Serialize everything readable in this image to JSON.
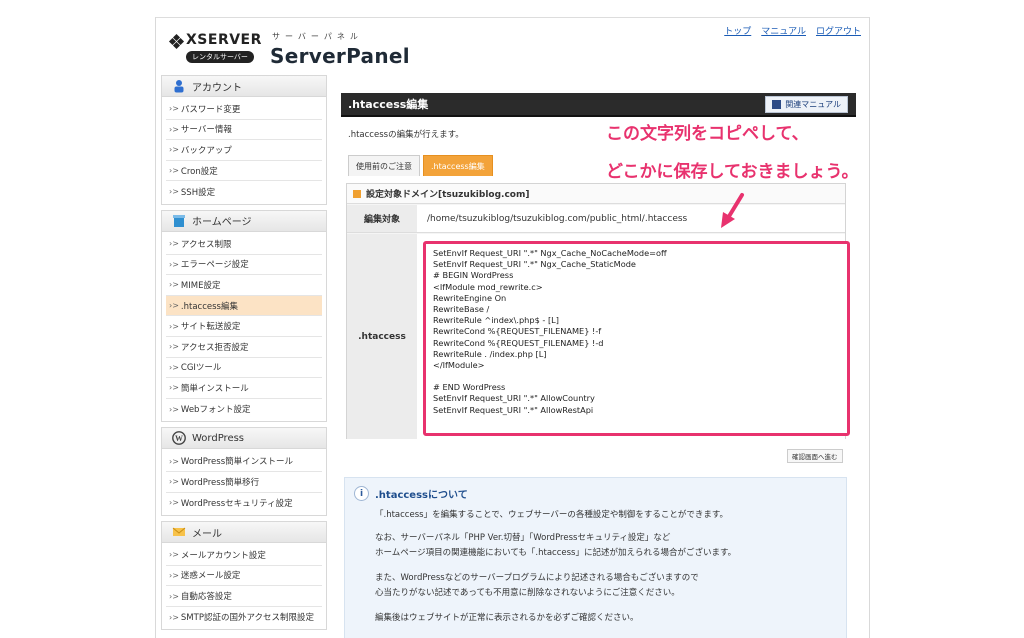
{
  "header": {
    "brand": "XSERVER",
    "badge": "レンタルサーバー",
    "kana": "サーバーパネル",
    "product": "ServerPanel",
    "links": [
      "トップ",
      "マニュアル",
      "ログアウト"
    ]
  },
  "sidebar": {
    "sections": [
      {
        "title": "アカウント",
        "icon": "person-icon",
        "items": [
          "パスワード変更",
          "サーバー情報",
          "バックアップ",
          "Cron設定",
          "SSH設定"
        ]
      },
      {
        "title": "ホームページ",
        "icon": "homepage-icon",
        "items": [
          "アクセス制限",
          "エラーページ設定",
          "MIME設定",
          ".htaccess編集",
          "サイト転送設定",
          "アクセス拒否設定",
          "CGIツール",
          "簡単インストール",
          "Webフォント設定"
        ]
      },
      {
        "title": "WordPress",
        "icon": "wordpress-icon",
        "items": [
          "WordPress簡単インストール",
          "WordPress簡単移行",
          "WordPressセキュリティ設定"
        ]
      },
      {
        "title": "メール",
        "icon": "mail-icon",
        "items": [
          "メールアカウント設定",
          "迷惑メール設定",
          "自動応答設定",
          "SMTP認証の国外アクセス制限設定"
        ]
      }
    ],
    "active_item": ".htaccess編集"
  },
  "main": {
    "title": ".htaccess編集",
    "manual_button": "関連マニュアル",
    "intro": ".htaccessの編集が行えます。",
    "tabs": [
      "使用前のご注意",
      ".htaccess編集"
    ],
    "active_tab": 1,
    "domain_label": "設定対象ドメイン[tsuzukiblog.com]",
    "target_label": "編集対象",
    "target_path": "/home/tsuzukiblog/tsuzukiblog.com/public_html/.htaccess",
    "htaccess_label": ".htaccess",
    "htaccess_lines": [
      "SetEnvIf Request_URI \".*\" Ngx_Cache_NoCacheMode=off",
      "SetEnvIf Request_URI \".*\" Ngx_Cache_StaticMode",
      "# BEGIN WordPress",
      "<IfModule mod_rewrite.c>",
      "RewriteEngine On",
      "RewriteBase /",
      "RewriteRule ^index\\.php$ - [L]",
      "RewriteCond %{REQUEST_FILENAME} !-f",
      "RewriteCond %{REQUEST_FILENAME} !-d",
      "RewriteRule . /index.php [L]",
      "</IfModule>",
      "",
      "# END WordPress",
      "SetEnvIf Request_URI \".*\" AllowCountry",
      "SetEnvIf Request_URI \".*\" AllowRestApi"
    ],
    "confirm_button": "確認画面へ進む"
  },
  "about": {
    "title": ".htaccessについて",
    "paragraphs": [
      [
        "「.htaccess」を編集することで、ウェブサーバーの各種設定や制御をすることができます。"
      ],
      [
        "なお、サーバーパネル「PHP Ver.切替」「WordPressセキュリティ設定」など",
        "ホームページ項目の関連機能においても「.htaccess」に記述が加えられる場合がございます。"
      ],
      [
        "また、WordPressなどのサーバープログラムにより記述される場合もございますので",
        "心当たりがない記述であっても不用意に削除なされないようにご注意ください。"
      ],
      [
        "編集後はウェブサイトが正常に表示されるかを必ずご確認ください。"
      ]
    ]
  },
  "annotation": {
    "line1": "この文字列をコピペして、",
    "line2": "どこかに保存しておきましょう。",
    "color": "#e8326e"
  }
}
